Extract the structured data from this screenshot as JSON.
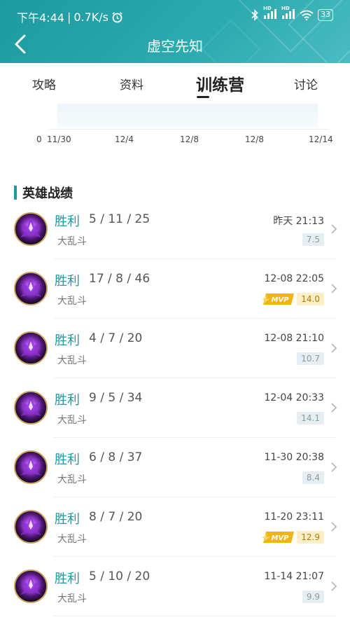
{
  "status": {
    "time": "下午4:44",
    "separator": "|",
    "speed": "0.7K/s",
    "battery": "33",
    "hd1": "HD",
    "hd2": "HD"
  },
  "header": {
    "title": "虚空先知"
  },
  "tabs": [
    {
      "label": "攻略"
    },
    {
      "label": "资料"
    },
    {
      "label": "训练营",
      "active": true
    },
    {
      "label": "讨论"
    }
  ],
  "chart_data": {
    "type": "area",
    "y_tick_labels": [
      "0"
    ],
    "x_tick_labels": [
      "11/30",
      "12/4",
      "12/8",
      "12/8",
      "12/14"
    ]
  },
  "section": {
    "title": "英雄战绩"
  },
  "matches": [
    {
      "result": "胜利",
      "kda": "5 / 11 / 25",
      "mode": "大乱斗",
      "time": "昨天 21:13",
      "score": "7.5",
      "mvp": false
    },
    {
      "result": "胜利",
      "kda": "17 / 8 / 46",
      "mode": "大乱斗",
      "time": "12-08 22:05",
      "score": "14.0",
      "mvp": true
    },
    {
      "result": "胜利",
      "kda": "4 / 7 / 20",
      "mode": "大乱斗",
      "time": "12-08 21:10",
      "score": "10.7",
      "mvp": false
    },
    {
      "result": "胜利",
      "kda": "9 / 5 / 34",
      "mode": "大乱斗",
      "time": "12-04 20:33",
      "score": "14.1",
      "mvp": false
    },
    {
      "result": "胜利",
      "kda": "6 / 8 / 37",
      "mode": "大乱斗",
      "time": "11-30 20:38",
      "score": "8.4",
      "mvp": false
    },
    {
      "result": "胜利",
      "kda": "8 / 7 / 20",
      "mode": "大乱斗",
      "time": "11-20 23:11",
      "score": "12.9",
      "mvp": true
    },
    {
      "result": "胜利",
      "kda": "5 / 10 / 20",
      "mode": "大乱斗",
      "time": "11-14 21:07",
      "score": "9.9",
      "mvp": false
    }
  ],
  "mvp_label": "MVP",
  "colors": {
    "accent": "#1e9aa1",
    "mvp_gold": "#f0b414"
  }
}
